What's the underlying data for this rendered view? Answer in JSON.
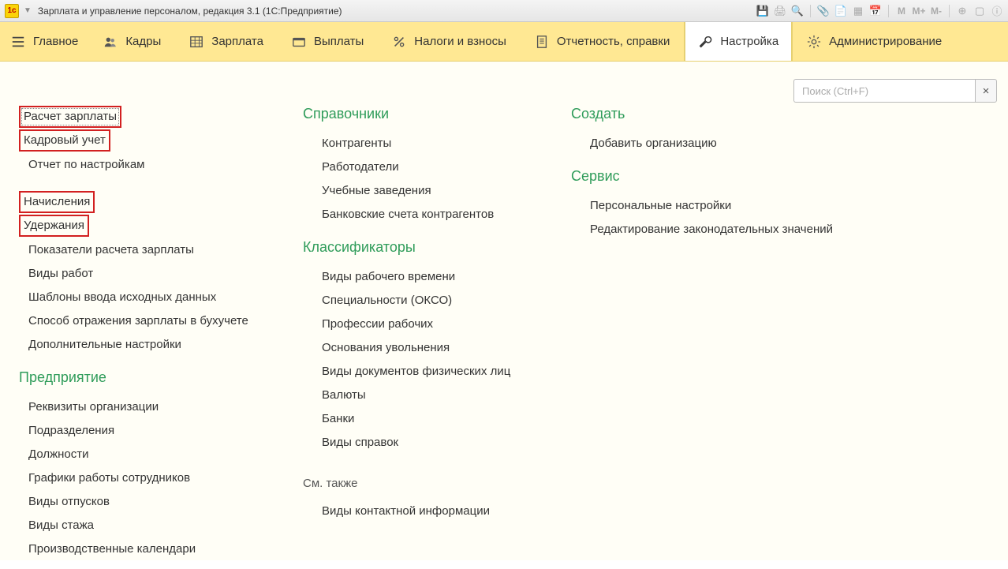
{
  "titlebar": {
    "app_title": "Зарплата и управление персоналом, редакция 3.1  (1С:Предприятие)"
  },
  "nav": {
    "items": [
      {
        "label": "Главное"
      },
      {
        "label": "Кадры"
      },
      {
        "label": "Зарплата"
      },
      {
        "label": "Выплаты"
      },
      {
        "label": "Налоги и взносы"
      },
      {
        "label": "Отчетность, справки"
      },
      {
        "label": "Настройка"
      },
      {
        "label": "Администрирование"
      }
    ]
  },
  "search": {
    "placeholder": "Поиск (Ctrl+F)",
    "clear": "×"
  },
  "col1": {
    "top": [
      "Расчет зарплаты",
      "Кадровый учет",
      "Отчет по настройкам"
    ],
    "mid": [
      "Начисления",
      "Удержания",
      "Показатели расчета зарплаты",
      "Виды работ",
      "Шаблоны ввода исходных данных",
      "Способ отражения зарплаты в бухучете",
      "Дополнительные настройки"
    ],
    "section2_title": "Предприятие",
    "section2": [
      "Реквизиты организации",
      "Подразделения",
      "Должности",
      "Графики работы сотрудников",
      "Виды отпусков",
      "Виды стажа",
      "Производственные календари"
    ]
  },
  "col2": {
    "s1_title": "Справочники",
    "s1": [
      "Контрагенты",
      "Работодатели",
      "Учебные заведения",
      "Банковские счета контрагентов"
    ],
    "s2_title": "Классификаторы",
    "s2": [
      "Виды рабочего времени",
      "Специальности (ОКСО)",
      "Профессии рабочих",
      "Основания увольнения",
      "Виды документов физических лиц",
      "Валюты",
      "Банки",
      "Виды справок"
    ],
    "see_also_label": "См. также",
    "see_also": [
      "Виды контактной информации"
    ]
  },
  "col3": {
    "s1_title": "Создать",
    "s1": [
      "Добавить организацию"
    ],
    "s2_title": "Сервис",
    "s2": [
      "Персональные настройки",
      "Редактирование законодательных значений"
    ]
  }
}
